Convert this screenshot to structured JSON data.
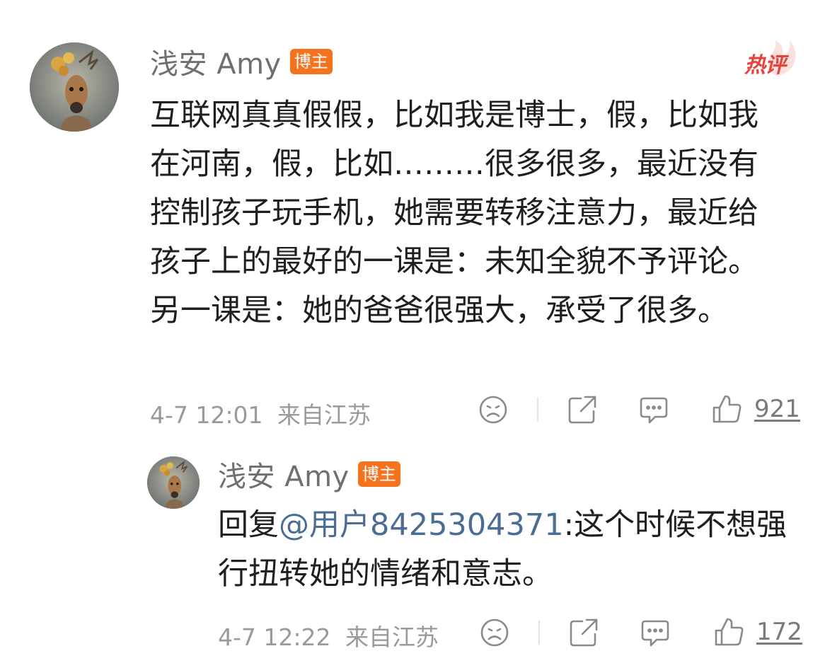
{
  "hot_tag": "热评",
  "comments": [
    {
      "author": "浅安 Amy",
      "badge": "博主",
      "text": "互联网真真假假，比如我是博士，假，比如我在河南，假，比如………很多很多，最近没有控制孩子玩手机，她需要转移注意力，最近给孩子上的最好的一课是：未知全貌不予评论。另一课是：她的爸爸很强大，承受了很多。",
      "time": "4-7 12:01",
      "location": "来自江苏",
      "likes": "921"
    },
    {
      "author": "浅安 Amy",
      "badge": "博主",
      "reply_prefix": "回复",
      "mention": "@用户8425304371",
      "text": ":这个时候不想强行扭转她的情绪和意志。",
      "time": "4-7 12:22",
      "location": "来自江苏",
      "likes": "172"
    }
  ],
  "icons": {
    "dislike": "sad-face-icon",
    "share": "share-icon",
    "comment": "comment-icon",
    "like": "thumbs-up-icon"
  },
  "colors": {
    "badge": "#f5721e",
    "hot": "#e5433b",
    "mention": "#4c6d93",
    "meta": "#9a9a9a"
  }
}
